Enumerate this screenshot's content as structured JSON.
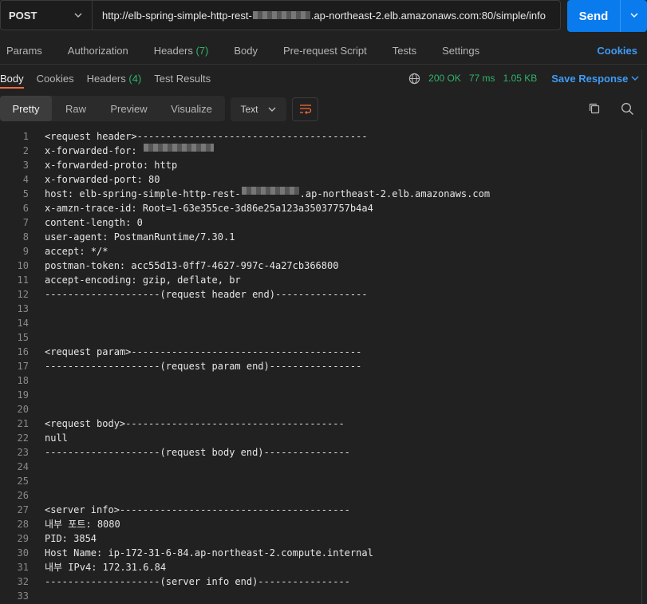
{
  "request": {
    "method": "POST",
    "url_prefix": "http://elb-spring-simple-http-rest-",
    "url_suffix": ".ap-northeast-2.elb.amazonaws.com:80/simple/info",
    "send_label": "Send"
  },
  "request_tabs": {
    "params": "Params",
    "authorization": "Authorization",
    "headers": "Headers",
    "headers_count": "(7)",
    "body": "Body",
    "pre_request": "Pre-request Script",
    "tests": "Tests",
    "settings": "Settings",
    "cookies": "Cookies"
  },
  "response_tabs": {
    "body": "Body",
    "cookies": "Cookies",
    "headers": "Headers",
    "headers_count": "(4)",
    "test_results": "Test Results"
  },
  "status": {
    "code": "200 OK",
    "time": "77 ms",
    "size": "1.05 KB",
    "save": "Save Response"
  },
  "format": {
    "pretty": "Pretty",
    "raw": "Raw",
    "preview": "Preview",
    "visualize": "Visualize",
    "text_type": "Text"
  },
  "colors": {
    "accent": "#097bed",
    "success": "#2fb36a",
    "link": "#3f9bf5",
    "tab_underline": "#f26b3a"
  },
  "icons": [
    "chevron-down-icon",
    "globe-icon",
    "wrap-lines-icon",
    "copy-icon",
    "search-icon"
  ],
  "code_lines": [
    "<request header>----------------------------------------",
    "x-forwarded-for: ",
    "x-forwarded-proto: http",
    "x-forwarded-port: 80",
    "host: elb-spring-simple-http-rest-",
    "x-amzn-trace-id: Root=1-63e355ce-3d86e25a123a35037757b4a4",
    "content-length: 0",
    "user-agent: PostmanRuntime/7.30.1",
    "accept: */*",
    "postman-token: acc55d13-0ff7-4627-997c-4a27cb366800",
    "accept-encoding: gzip, deflate, br",
    "--------------------(request header end)----------------",
    "",
    "",
    "",
    "<request param>----------------------------------------",
    "--------------------(request param end)----------------",
    "",
    "",
    "",
    "<request body>--------------------------------------",
    "null",
    "--------------------(request body end)---------------",
    "",
    "",
    "",
    "<server info>----------------------------------------",
    "내부 포트: 8080",
    "PID: 3854",
    "Host Name: ip-172-31-6-84.ap-northeast-2.compute.internal",
    "내부 IPv4: 172.31.6.84",
    "--------------------(server info end)----------------",
    ""
  ],
  "host_suffix": ".ap-northeast-2.elb.amazonaws.com"
}
